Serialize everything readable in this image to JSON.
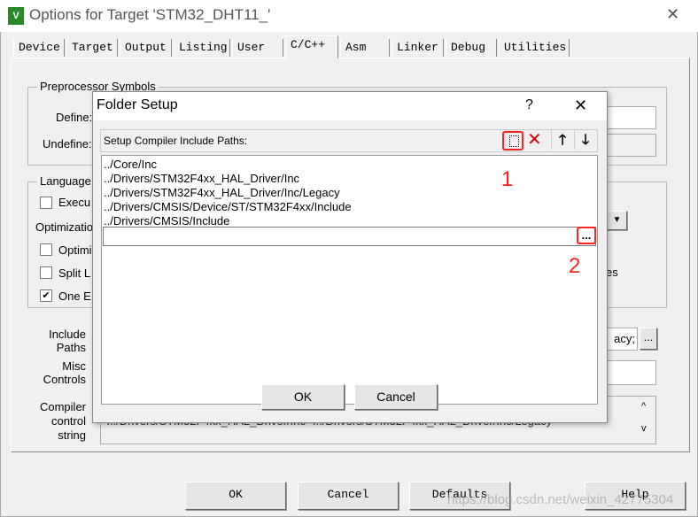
{
  "window": {
    "title": "Options for Target 'STM32_DHT11_'",
    "close": "✕"
  },
  "tabs": [
    "Device",
    "Target",
    "Output",
    "Listing",
    "User",
    "C/C++",
    "Asm",
    "Linker",
    "Debug",
    "Utilities"
  ],
  "active_tab": "C/C++",
  "background": {
    "preprocessor_group": "Preprocessor Symbols",
    "define_label": "Define:",
    "undefine_label": "Undefine:",
    "language_group": "Language",
    "execute_label": "Execu",
    "optimization_label": "Optimizatio",
    "optimize_label": "Optimi",
    "split_label": "Split L",
    "one_label": "One E",
    "one_checked": true,
    "es_text": "es",
    "include_label_1": "Include",
    "include_label_2": "Paths",
    "include_value": "acy;",
    "browse": "...",
    "misc_label_1": "Misc",
    "misc_label_2": "Controls",
    "compiler_label_1": "Compiler",
    "compiler_label_2": "control",
    "compiler_label_3": "string",
    "compiler_value": "-I../Drivers/STM32F4xx_HAL_Driver/Inc -I../Drivers/STM32F4xx_HAL_Driver/Inc/Legacy -"
  },
  "dialog": {
    "title": "Folder Setup",
    "help": "?",
    "close": "✕",
    "toolbar_label": "Setup Compiler Include Paths:",
    "toolbar_icons": [
      "new-folder-icon",
      "delete-icon",
      "move-up-icon",
      "move-down-icon"
    ],
    "paths": [
      "../Core/Inc",
      "../Drivers/STM32F4xx_HAL_Driver/Inc",
      "../Drivers/STM32F4xx_HAL_Driver/Inc/Legacy",
      "../Drivers/CMSIS/Device/ST/STM32F4xx/Include",
      "../Drivers/CMSIS/Include"
    ],
    "edit_value": "",
    "browse": "...",
    "ok": "OK",
    "cancel": "Cancel"
  },
  "annotations": {
    "one": "1",
    "two": "2",
    "color": "#ff2020"
  },
  "buttons": {
    "ok": "OK",
    "cancel": "Cancel",
    "defaults": "Defaults",
    "help": "Help"
  },
  "watermark": "https://blog.csdn.net/weixin_42775304"
}
